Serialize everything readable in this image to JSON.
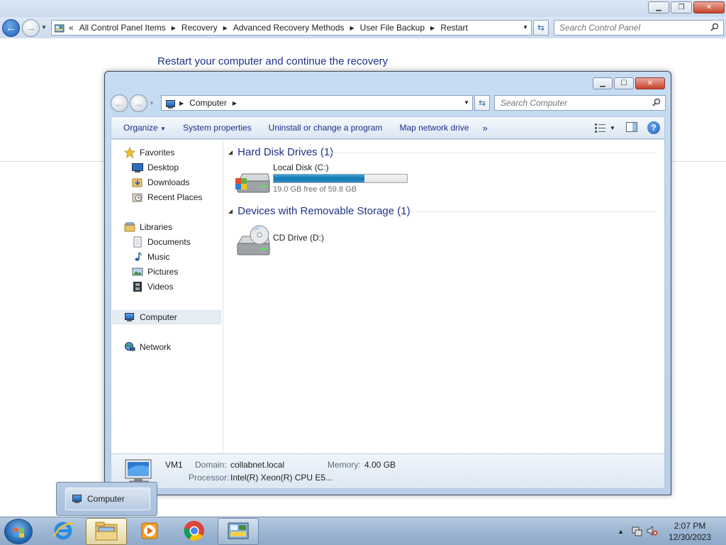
{
  "outer_window": {
    "breadcrumb": [
      "All Control Panel Items",
      "Recovery",
      "Advanced Recovery Methods",
      "User File Backup",
      "Restart"
    ],
    "breadcrumb_overflow": "«",
    "search_placeholder": "Search Control Panel",
    "heading": "Restart your computer and continue the recovery"
  },
  "explorer": {
    "breadcrumb": [
      "Computer"
    ],
    "search_placeholder": "Search Computer",
    "toolbar": {
      "organize": "Organize",
      "system_properties": "System properties",
      "uninstall": "Uninstall or change a program",
      "map_drive": "Map network drive",
      "more": "»"
    },
    "nav": {
      "favorites": "Favorites",
      "desktop": "Desktop",
      "downloads": "Downloads",
      "recent_places": "Recent Places",
      "libraries": "Libraries",
      "documents": "Documents",
      "music": "Music",
      "pictures": "Pictures",
      "videos": "Videos",
      "computer": "Computer",
      "network": "Network"
    },
    "groups": {
      "hard_disk": "Hard Disk Drives (1)",
      "removable": "Devices with Removable Storage (1)"
    },
    "drives": {
      "c_name": "Local Disk (C:)",
      "c_free": "19.0 GB free of 59.8 GB",
      "c_used_fraction": 0.68,
      "d_name": "CD Drive (D:)"
    },
    "details": {
      "name": "VM1",
      "domain_label": "Domain:",
      "domain_value": "collabnet.local",
      "memory_label": "Memory:",
      "memory_value": "4.00 GB",
      "processor_label": "Processor:",
      "processor_value": "Intel(R) Xeon(R) CPU E5..."
    }
  },
  "taskbar": {
    "thumbnail_label": "Computer",
    "time": "2:07 PM",
    "date": "12/30/2023",
    "apps": [
      "start-orb",
      "internet-explorer",
      "windows-explorer",
      "media-player",
      "chrome",
      "control-panel"
    ]
  }
}
